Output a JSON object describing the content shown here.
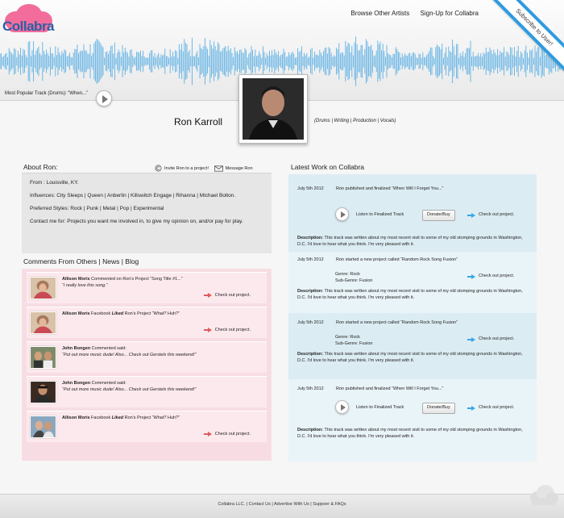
{
  "brand": {
    "logo_text": "Collabra"
  },
  "nav": {
    "browse": "Browse Other Artists",
    "signup": "Sign-Up for Collabra"
  },
  "ribbon": {
    "label": "Subscribe to User!"
  },
  "popular_track": {
    "label": "Most Popular Track (Drums): “When...”"
  },
  "profile": {
    "name": "Ron Karroll",
    "roles": "(Drums | Writing | Production | Vocals)"
  },
  "about": {
    "title": "About Ron:",
    "invite_label": "Invite Ron to a project!",
    "message_label": "Message Ron",
    "from": "From : Louisville, KY.",
    "influences": "Influences: City Sleeps | Queen | Anberlin | Killswitch Engage | Rihanna | Michael Bolton.",
    "styles": "Preferred Styles: Rock | Punk | Metal | Pop | Experimental",
    "contact": "Contact me for:  Projects you want me involved in, to give my opinion on, and/or pay for play."
  },
  "comments": {
    "title": "Comments From Others | News | Blog",
    "check_label": "Check out project.",
    "items": [
      {
        "author": "Allison Moris",
        "action": " Commented on Ron's Project “Song Title #1...”",
        "quote": "“I really love this song.”",
        "has_check": true
      },
      {
        "author": "Allison Moris",
        "action_pre": " Facebook ",
        "liked": "Liked",
        "action": " Ron's Project “What? Huh?”",
        "quote": "",
        "has_check": true
      },
      {
        "author": "John Bongen",
        "action": " Commented said:",
        "quote": "“Put out more music dude! Also... Check out Gerstels this weekend!”",
        "has_check": false
      },
      {
        "author": "John Bongen",
        "action": " Commented said:",
        "quote": "“Put out more music dude! Also... Check out Gerstels this weekend!”",
        "has_check": false
      },
      {
        "author": "Allison Moris",
        "action_pre": " Facebook ",
        "liked": "Liked",
        "action": " Ron's Project “What? Huh?”",
        "quote": "",
        "has_check": true
      }
    ]
  },
  "latest": {
    "title": "Latest Work on Collabra",
    "listen_label": "Listen to Finalized Track",
    "donate_label": "Donate/Buy",
    "check_label": "Check out project.",
    "desc_label": "Description:",
    "items": [
      {
        "date": "July 5th 2012",
        "headline": "Ron published and finalized “When Will I Forget You...”",
        "desc": " This track was written about my most recent visit to some of my old stomping grounds  in Washington, D.C.  I'd love to hear what you think.  I'm very pleased with it."
      },
      {
        "date": "July 5th 2012",
        "headline": "Ron started a new project called “Random Rock Song Fusion”",
        "genre": "Genre: Rock",
        "subgenre": "Sub-Genre: Fusion",
        "desc": " This track was written about my most recent visit to some of my old stomping grounds  in Washington, D.C.  I'd love to hear what you think.  I'm very pleased with it."
      },
      {
        "date": "July 5th 2012",
        "headline": "Ron started a new project called “Random Rock Song Fusion”",
        "genre": "Genre: Rock",
        "subgenre": "Sub-Genre: Fusion",
        "desc": " This track was written about my most recent visit to some of my old stomping grounds  in Washington, D.C.  I'd love to hear what you think.  I'm very pleased with it."
      },
      {
        "date": "July 5th 2012",
        "headline": "Ron published and finalized “When Will I Forget You...”",
        "desc": " This track was written about my most recent visit to some of my old stomping grounds  in Washington, D.C.  I'd love to hear what you think.  I'm very pleased with it."
      }
    ]
  },
  "footer": {
    "company": "Collabra LLC.",
    "contact": "Contact Us",
    "advertise": "Advertise With Us",
    "support": "Suppoer & FAQs"
  },
  "colors": {
    "accent_blue": "#2d9be0",
    "pink_panel": "#f7dde3",
    "blue_panel": "#dcecf3",
    "logo_pink": "#f26d9b"
  }
}
